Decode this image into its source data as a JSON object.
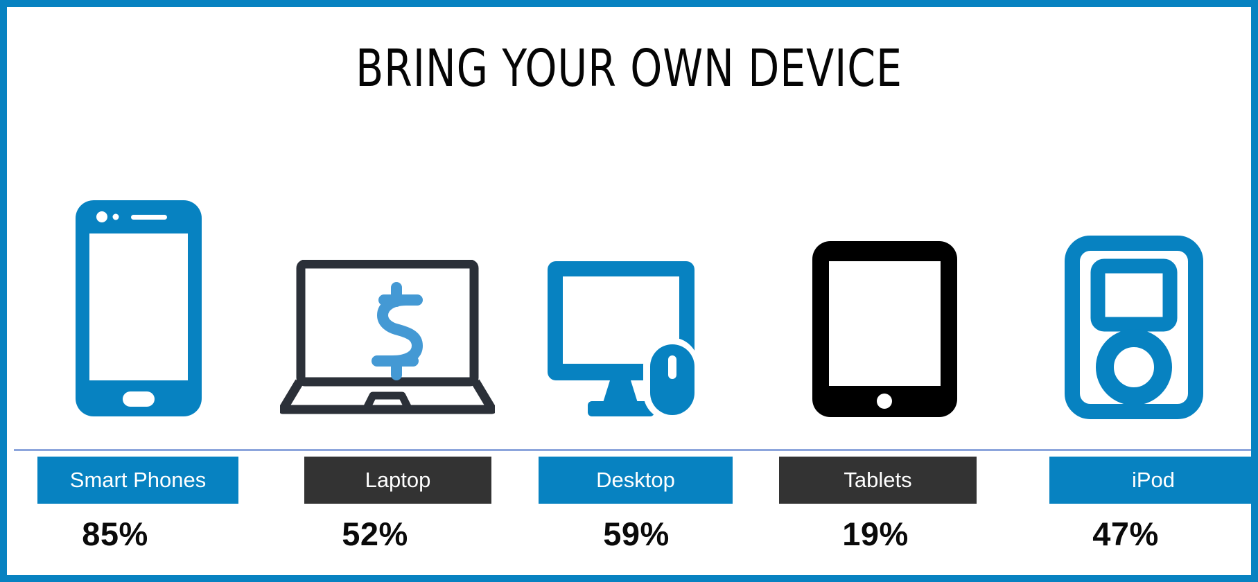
{
  "frame": {
    "border_color": "#0782C1",
    "background": "#FFFFFF"
  },
  "header": {
    "title": "BRING YOUR OWN DEVICE"
  },
  "palette": {
    "blue": "#0782C1",
    "light_blue": "#4499D4",
    "dark": "#333333",
    "laptop_outline": "#2B3038",
    "black": "#000000",
    "divider": "#8CA5DC",
    "white": "#FFFFFF"
  },
  "chart_data": {
    "type": "bar",
    "title": "BRING YOUR OWN DEVICE",
    "xlabel": "",
    "ylabel": "",
    "categories": [
      "Smart Phones",
      "Laptop",
      "Desktop",
      "Tablets",
      "iPod"
    ],
    "values": [
      85,
      52,
      59,
      19,
      47
    ],
    "value_labels": [
      "85%",
      "52%",
      "59%",
      "19%",
      "47%"
    ],
    "unit": "%",
    "legend": "none",
    "grid": false,
    "ylim": [
      0,
      100
    ]
  },
  "devices": [
    {
      "key": "smart-phones",
      "label": "Smart Phones",
      "percent": "85%",
      "bar_style": "blue",
      "icon": "smartphone-icon",
      "icon_color": "#0782C1"
    },
    {
      "key": "laptop",
      "label": "Laptop",
      "percent": "52%",
      "bar_style": "dark",
      "icon": "laptop-dollar-icon",
      "icon_color": "#2B3038"
    },
    {
      "key": "desktop",
      "label": "Desktop",
      "percent": "59%",
      "bar_style": "blue",
      "icon": "desktop-monitor-mouse-icon",
      "icon_color": "#0782C1"
    },
    {
      "key": "tablets",
      "label": "Tablets",
      "percent": "19%",
      "bar_style": "dark",
      "icon": "tablet-icon",
      "icon_color": "#000000"
    },
    {
      "key": "ipod",
      "label": "iPod",
      "percent": "47%",
      "bar_style": "blue",
      "icon": "ipod-icon",
      "icon_color": "#0782C1"
    }
  ]
}
